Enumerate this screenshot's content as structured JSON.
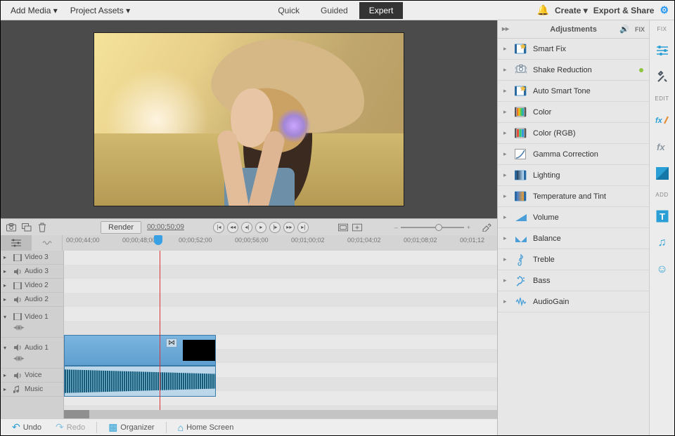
{
  "topbar": {
    "add_media": "Add Media",
    "project_assets": "Project Assets",
    "modes": {
      "quick": "Quick",
      "guided": "Guided",
      "expert": "Expert",
      "active": "Expert"
    },
    "create": "Create",
    "export_share": "Export & Share"
  },
  "transport": {
    "render": "Render",
    "timecode": "00;00;50;09"
  },
  "ruler": {
    "ticks": [
      "00;00;44;00",
      "00;00;48;00",
      "00;00;52;00",
      "00;00;56;00",
      "00;01;00;02",
      "00;01;04;02",
      "00;01;08;02",
      "00;01;12"
    ]
  },
  "tracks": [
    {
      "icon": "▸",
      "type": "film",
      "label": "Video 3"
    },
    {
      "icon": "▸",
      "type": "speaker",
      "label": "Audio 3"
    },
    {
      "icon": "▸",
      "type": "film",
      "label": "Video 2"
    },
    {
      "icon": "▸",
      "type": "speaker",
      "label": "Audio 2"
    },
    {
      "icon": "▾",
      "type": "film",
      "label": "Video 1",
      "tall": true
    },
    {
      "icon": "▾",
      "type": "speaker",
      "label": "Audio 1",
      "tall": true
    },
    {
      "icon": "▸",
      "type": "speaker",
      "label": "Voice"
    },
    {
      "icon": "▸",
      "type": "music",
      "label": "Music"
    }
  ],
  "adjustments": {
    "title": "Adjustments",
    "fix_label": "FIX",
    "items": [
      {
        "icon": "smartfix",
        "label": "Smart Fix"
      },
      {
        "icon": "shake",
        "label": "Shake Reduction",
        "dot": true
      },
      {
        "icon": "autotone",
        "label": "Auto Smart Tone"
      },
      {
        "icon": "color",
        "label": "Color"
      },
      {
        "icon": "colorrgb",
        "label": "Color (RGB)"
      },
      {
        "icon": "gamma",
        "label": "Gamma Correction"
      },
      {
        "icon": "lighting",
        "label": "Lighting"
      },
      {
        "icon": "temptint",
        "label": "Temperature and Tint"
      },
      {
        "icon": "volume",
        "label": "Volume"
      },
      {
        "icon": "balance",
        "label": "Balance"
      },
      {
        "icon": "treble",
        "label": "Treble"
      },
      {
        "icon": "bass",
        "label": "Bass"
      },
      {
        "icon": "audiogain",
        "label": "AudioGain"
      }
    ]
  },
  "toolstrip": {
    "fix_label": "FIX",
    "edit_label": "EDIT",
    "add_label": "ADD"
  },
  "bottombar": {
    "undo": "Undo",
    "redo": "Redo",
    "organizer": "Organizer",
    "home": "Home Screen"
  }
}
